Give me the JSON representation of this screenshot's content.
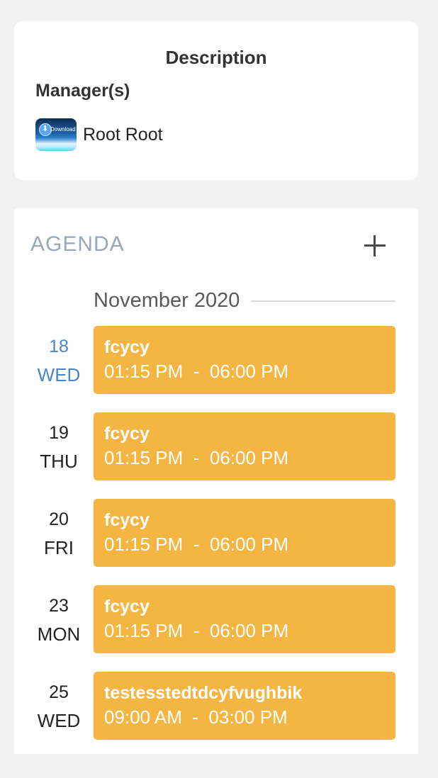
{
  "description_card": {
    "title": "Description",
    "managers_label": "Manager(s)",
    "manager": {
      "avatar_text": "Download",
      "name": "Root Root"
    }
  },
  "agenda": {
    "title": "AGENDA",
    "add_icon": "plus-icon",
    "month": "November 2020",
    "accent_color": "#f4b543",
    "today_color": "#4a86c8",
    "events": [
      {
        "day": "18",
        "weekday": "WED",
        "title": "fcycy",
        "start": "01:15 PM",
        "end": "06:00 PM",
        "today": true
      },
      {
        "day": "19",
        "weekday": "THU",
        "title": "fcycy",
        "start": "01:15 PM",
        "end": "06:00 PM",
        "today": false
      },
      {
        "day": "20",
        "weekday": "FRI",
        "title": "fcycy",
        "start": "01:15 PM",
        "end": "06:00 PM",
        "today": false
      },
      {
        "day": "23",
        "weekday": "MON",
        "title": "fcycy",
        "start": "01:15 PM",
        "end": "06:00 PM",
        "today": false
      },
      {
        "day": "25",
        "weekday": "WED",
        "title": "testesstedtdcyfvughbik",
        "start": "09:00 AM",
        "end": "03:00 PM",
        "today": false
      }
    ]
  }
}
